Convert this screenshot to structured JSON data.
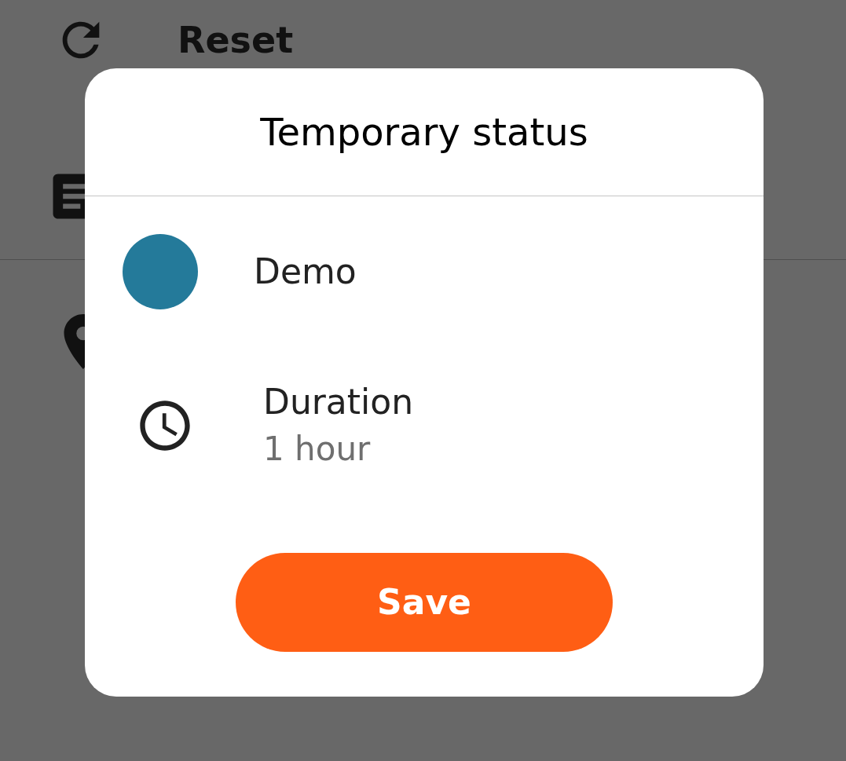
{
  "background": {
    "reset_label": "Reset"
  },
  "dialog": {
    "title": "Temporary status",
    "status": {
      "label": "Demo",
      "color": "#247a9a"
    },
    "duration": {
      "label": "Duration",
      "value": "1 hour"
    },
    "save_button": "Save"
  }
}
